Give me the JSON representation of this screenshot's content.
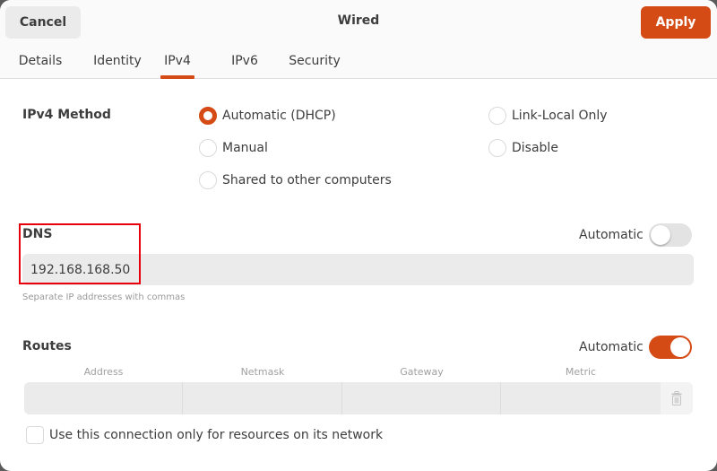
{
  "header": {
    "title": "Wired",
    "cancel_label": "Cancel",
    "apply_label": "Apply",
    "accent_color": "#d54b16"
  },
  "tabs": [
    {
      "label": "Details",
      "active": false
    },
    {
      "label": "Identity",
      "active": false
    },
    {
      "label": "IPv4",
      "active": true
    },
    {
      "label": "IPv6",
      "active": false
    },
    {
      "label": "Security",
      "active": false
    }
  ],
  "ipv4_method": {
    "label": "IPv4 Method",
    "options": [
      {
        "label": "Automatic (DHCP)",
        "checked": true
      },
      {
        "label": "Manual",
        "checked": false
      },
      {
        "label": "Shared to other computers",
        "checked": false
      },
      {
        "label": "Link-Local Only",
        "checked": false
      },
      {
        "label": "Disable",
        "checked": false
      }
    ]
  },
  "dns": {
    "label": "DNS",
    "automatic_label": "Automatic",
    "automatic_on": false,
    "value": "192.168.168.50",
    "hint": "Separate IP addresses with commas"
  },
  "routes": {
    "label": "Routes",
    "automatic_label": "Automatic",
    "automatic_on": true,
    "columns": [
      "Address",
      "Netmask",
      "Gateway",
      "Metric"
    ],
    "rows": [
      {
        "address": "",
        "netmask": "",
        "gateway": "",
        "metric": ""
      }
    ],
    "delete_icon": "trash-icon"
  },
  "only_local": {
    "label": "Use this connection only for resources on its network",
    "checked": false
  }
}
